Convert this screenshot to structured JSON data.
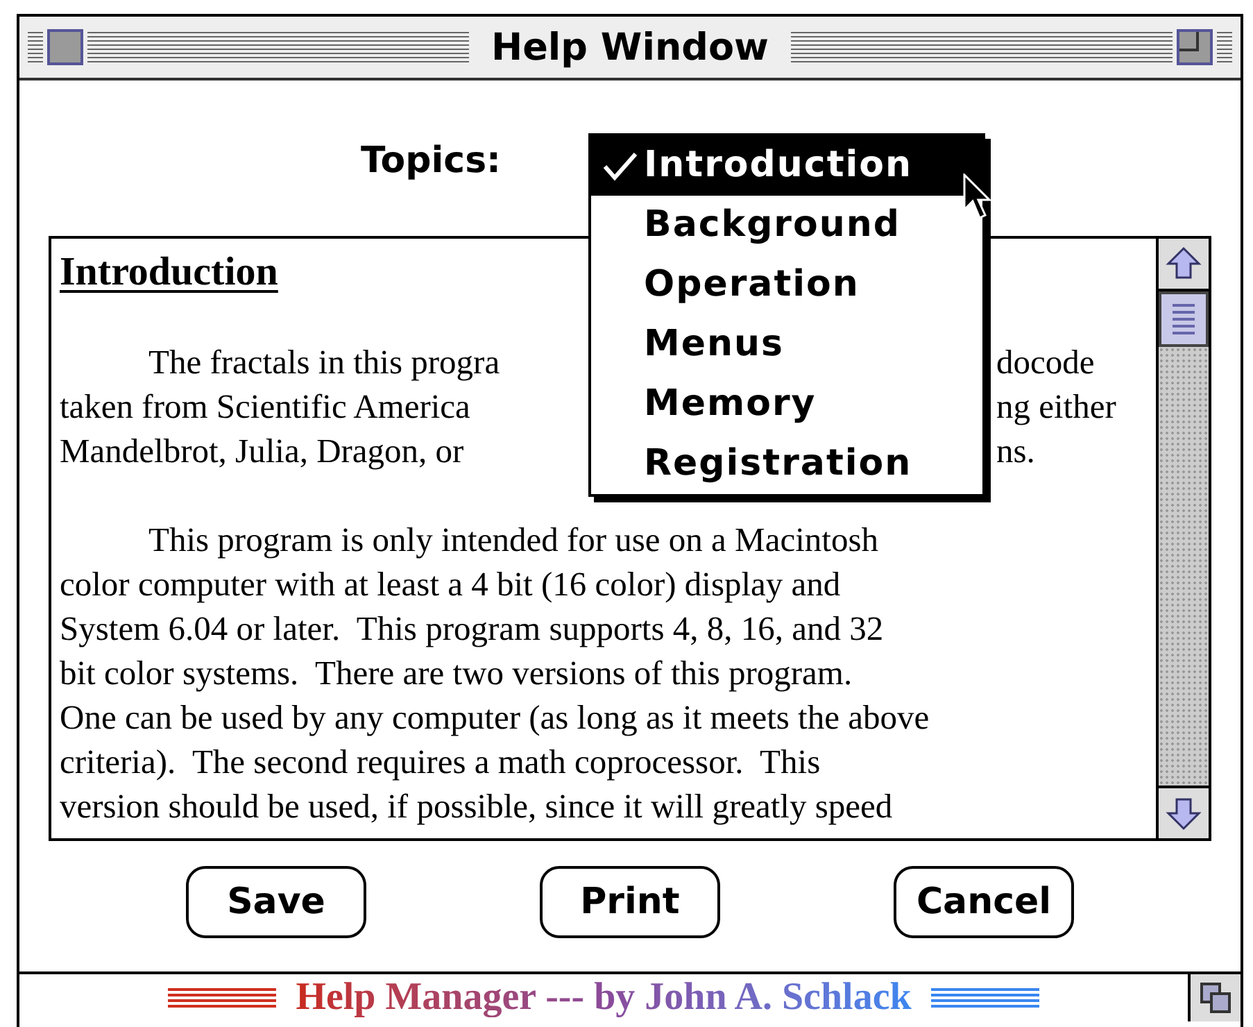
{
  "window": {
    "title": "Help Window"
  },
  "topics": {
    "label": "Topics:",
    "items": [
      {
        "label": "Introduction",
        "selected": true
      },
      {
        "label": "Background",
        "selected": false
      },
      {
        "label": "Operation",
        "selected": false
      },
      {
        "label": "Menus",
        "selected": false
      },
      {
        "label": "Memory",
        "selected": false
      },
      {
        "label": "Registration",
        "selected": false
      }
    ]
  },
  "document": {
    "heading": "Introduction",
    "paragraphs": [
      {
        "lines": [
          {
            "text": "The fractals in this progra",
            "right": "docode"
          },
          {
            "text": "taken from Scientific America",
            "right": "ng either"
          },
          {
            "text": "Mandelbrot, Julia, Dragon, or",
            "right": "ns."
          }
        ]
      },
      {
        "lines": [
          {
            "text": "This program is only intended for use on a Macintosh"
          },
          {
            "text": "color computer with at least a 4 bit (16 color) display and"
          },
          {
            "text": "System 6.04 or later.  This program supports 4, 8, 16, and 32"
          },
          {
            "text": "bit color systems.  There are two versions of this program."
          },
          {
            "text": "One can be used by any computer (as long as it meets the above"
          },
          {
            "text": "criteria).  The second requires a math coprocessor.  This"
          },
          {
            "text": "version should be used, if possible, since it will greatly speed"
          }
        ]
      }
    ]
  },
  "buttons": [
    "Save",
    "Print",
    "Cancel"
  ],
  "footer": "Help Manager --- by John A. Schlack"
}
